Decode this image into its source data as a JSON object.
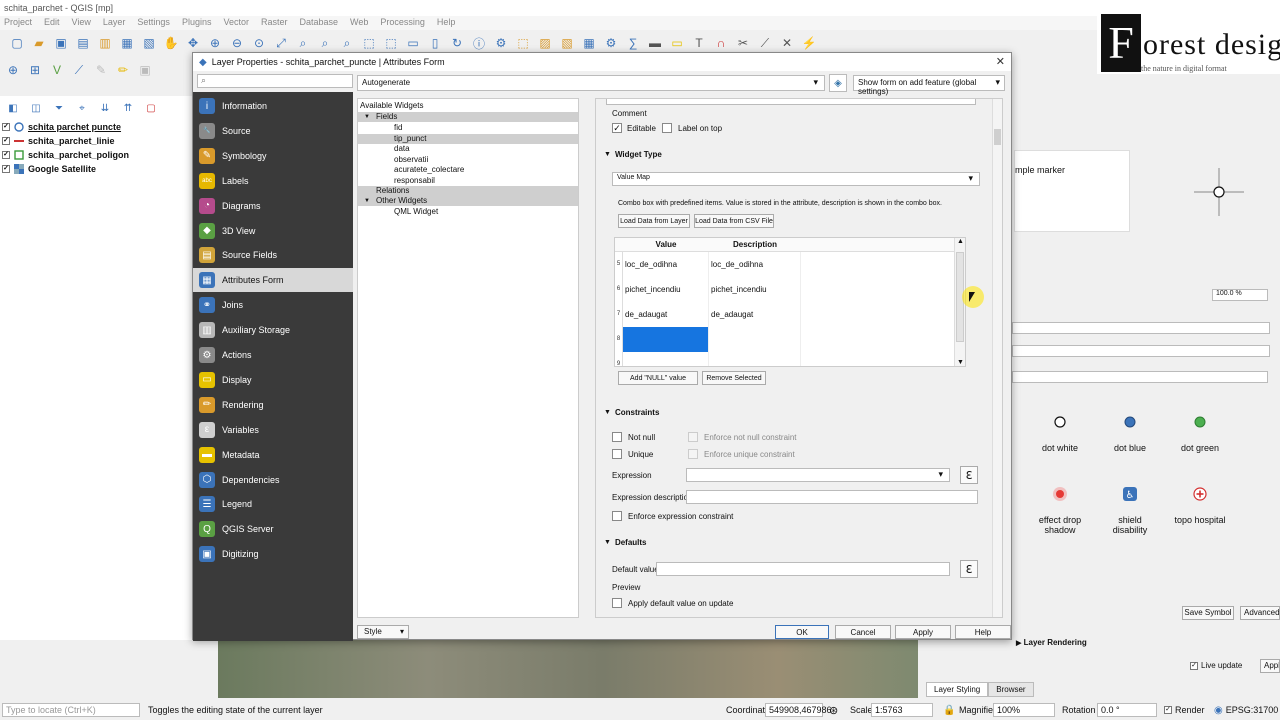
{
  "app": {
    "window_title": "schita_parchet - QGIS [mp]",
    "menu": [
      "Project",
      "Edit",
      "View",
      "Layer",
      "Settings",
      "Plugins",
      "Vector",
      "Raster",
      "Database",
      "Web",
      "Processing",
      "Help"
    ]
  },
  "layers": [
    {
      "name": "schita parchet puncte",
      "checked": true,
      "icon": "circle-point-icon"
    },
    {
      "name": "schita_parchet_linie",
      "checked": true,
      "icon": "line-icon"
    },
    {
      "name": "schita_parchet_poligon",
      "checked": true,
      "icon": "polygon-icon"
    },
    {
      "name": "Google Satellite",
      "checked": true,
      "icon": "raster-icon"
    }
  ],
  "logo": {
    "letter": "F",
    "word": "orest  desig",
    "tagline": "the nature in digital format"
  },
  "dialog": {
    "title": "Layer Properties - schita_parchet_puncte | Attributes Form",
    "close": "✕",
    "form_type": "Autogenerate",
    "show_form_option": "Show form on add feature (global settings)",
    "nav": [
      {
        "label": "Information",
        "icon": "info-icon",
        "color": "#3b73b9",
        "glyph": "i"
      },
      {
        "label": "Source",
        "icon": "wrench-icon",
        "color": "#8a8a8a",
        "glyph": "🔧"
      },
      {
        "label": "Symbology",
        "icon": "paintbrush-icon",
        "color": "#d99a2b",
        "glyph": "✎"
      },
      {
        "label": "Labels",
        "icon": "labels-icon",
        "color": "#e6b800",
        "glyph": "abc"
      },
      {
        "label": "Diagrams",
        "icon": "diagram-icon",
        "color": "#b54b8c",
        "glyph": "◔"
      },
      {
        "label": "3D View",
        "icon": "cube-icon",
        "color": "#5aa043",
        "glyph": "◆"
      },
      {
        "label": "Source Fields",
        "icon": "fields-icon",
        "color": "#d1a43a",
        "glyph": "▤"
      },
      {
        "label": "Attributes Form",
        "icon": "form-icon",
        "color": "#3b73b9",
        "glyph": "▦"
      },
      {
        "label": "Joins",
        "icon": "join-icon",
        "color": "#3b73b9",
        "glyph": "⚭"
      },
      {
        "label": "Auxiliary Storage",
        "icon": "storage-icon",
        "color": "#b8b8b8",
        "glyph": "▥"
      },
      {
        "label": "Actions",
        "icon": "gear-icon",
        "color": "#8a8a8a",
        "glyph": "⚙"
      },
      {
        "label": "Display",
        "icon": "speech-bubble-icon",
        "color": "#e6c200",
        "glyph": "▭"
      },
      {
        "label": "Rendering",
        "icon": "brush-icon",
        "color": "#d99a2b",
        "glyph": "✏"
      },
      {
        "label": "Variables",
        "icon": "variables-icon",
        "color": "#cfcfcf",
        "glyph": "ε"
      },
      {
        "label": "Metadata",
        "icon": "metadata-icon",
        "color": "#e6c200",
        "glyph": "▬"
      },
      {
        "label": "Dependencies",
        "icon": "dependencies-icon",
        "color": "#3b73b9",
        "glyph": "⬡"
      },
      {
        "label": "Legend",
        "icon": "legend-icon",
        "color": "#3b73b9",
        "glyph": "☰"
      },
      {
        "label": "QGIS Server",
        "icon": "server-icon",
        "color": "#5aa043",
        "glyph": "Q"
      },
      {
        "label": "Digitizing",
        "icon": "digitizing-icon",
        "color": "#3b73b9",
        "glyph": "▣"
      }
    ],
    "widgets_tree": {
      "root": "Available Widgets",
      "fields_group": "Fields",
      "fields": [
        "fid",
        "tip_punct",
        "data",
        "observatii",
        "acuratete_colectare",
        "responsabil"
      ],
      "relations": "Relations",
      "other_group": "Other Widgets",
      "other": [
        "QML Widget"
      ]
    },
    "config": {
      "comment_label": "Comment",
      "editable_label": "Editable",
      "label_on_top": "Label on top",
      "widget_type_section": "Widget Type",
      "widget_type_value": "Value Map",
      "widget_desc": "Combo box with predefined items. Value is stored in the attribute, description is shown in the combo box.",
      "load_layer_btn": "Load Data from Layer",
      "load_csv_btn": "Load Data from CSV File",
      "table_headers": [
        "Value",
        "Description"
      ],
      "table_rows": [
        {
          "num": "5",
          "value": "loc_de_odihna",
          "description": "loc_de_odihna"
        },
        {
          "num": "6",
          "value": "pichet_incendiu",
          "description": "pichet_incendiu"
        },
        {
          "num": "7",
          "value": "de_adaugat",
          "description": "de_adaugat"
        },
        {
          "num": "8",
          "value": "",
          "description": ""
        },
        {
          "num": "9",
          "value": "",
          "description": ""
        }
      ],
      "add_null_btn": "Add \"NULL\" value",
      "remove_btn": "Remove Selected",
      "constraints_section": "Constraints",
      "not_null": "Not null",
      "enforce_not_null": "Enforce not null constraint",
      "unique": "Unique",
      "enforce_unique": "Enforce unique constraint",
      "expression_label": "Expression",
      "expression_desc_label": "Expression description",
      "enforce_expression": "Enforce expression constraint",
      "defaults_section": "Defaults",
      "default_value_label": "Default value",
      "preview_label": "Preview",
      "apply_default_on_update": "Apply default value on update"
    },
    "footer": {
      "style": "Style",
      "ok": "OK",
      "cancel": "Cancel",
      "apply": "Apply",
      "help": "Help"
    }
  },
  "right_panel": {
    "marker_label": "mple marker",
    "opacity": "100.0 %",
    "symbols": [
      {
        "label": "dot  white",
        "icon": "dot-white-icon"
      },
      {
        "label": "dot blue",
        "icon": "dot-blue-icon"
      },
      {
        "label": "dot green",
        "icon": "dot-green-icon"
      },
      {
        "label": "effect drop shadow",
        "icon": "effect-drop-shadow-icon"
      },
      {
        "label": "shield disability",
        "icon": "shield-disability-icon"
      },
      {
        "label": "topo hospital",
        "icon": "topo-hospital-icon"
      }
    ],
    "save_symbol": "Save Symbol",
    "advanced": "Advanced",
    "layer_rendering": "Layer Rendering",
    "live_update": "Live update",
    "apply_short": "Appl",
    "tabs": [
      "Layer Styling",
      "Browser"
    ]
  },
  "statusbar": {
    "locate_placeholder": "Type to locate (Ctrl+K)",
    "message": "Toggles the editing state of the current layer",
    "coordinate_label": "Coordinate",
    "coordinate": "549908,467986",
    "scale_label": "Scale",
    "scale": "1:5763",
    "magnifier_label": "Magnifier",
    "magnifier": "100%",
    "rotation_label": "Rotation",
    "rotation": "0.0 °",
    "render_label": "Render",
    "crs": "EPSG:31700"
  }
}
